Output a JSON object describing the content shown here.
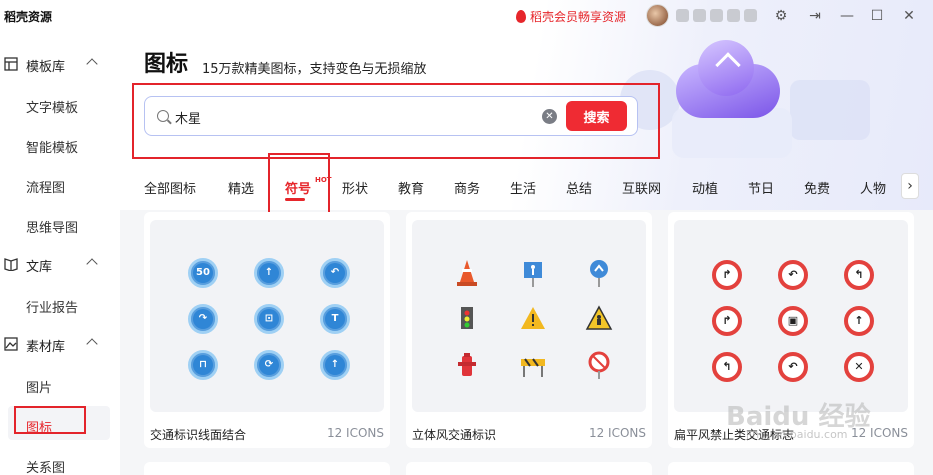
{
  "app": {
    "brand": "稻壳资源",
    "vip_label": "稻壳会员畅享资源"
  },
  "sidebar": {
    "groups": [
      {
        "label": "模板库",
        "icon": "template-icon",
        "items": [
          "文字模板",
          "智能模板",
          "流程图",
          "思维导图"
        ]
      },
      {
        "label": "文库",
        "icon": "book-icon",
        "items": [
          "行业报告"
        ]
      },
      {
        "label": "素材库",
        "icon": "image-icon",
        "items": [
          "图片",
          "图标",
          "关系图"
        ]
      }
    ],
    "active_item": "图标"
  },
  "header": {
    "title": "图标",
    "subtitle": "15万款精美图标，支持变色与无损缩放"
  },
  "search": {
    "value": "木星",
    "button_label": "搜索"
  },
  "tabs": {
    "items": [
      "全部图标",
      "精选",
      "符号",
      "形状",
      "教育",
      "商务",
      "生活",
      "总结",
      "互联网",
      "动植",
      "节日",
      "免费",
      "人物"
    ],
    "active": "符号",
    "hot_label": "HOT",
    "next_label": "›"
  },
  "cards": [
    {
      "title": "交通标识线面结合",
      "count": "12 ICONS",
      "icons": [
        "50",
        "↑",
        "↶",
        "↷",
        "⊡",
        "T",
        "⊓",
        "⟳",
        "↑"
      ]
    },
    {
      "title": "立体风交通标识",
      "count": "12 ICONS",
      "icons": [
        "cone",
        "sign-person",
        "sign-arrow",
        "traffic-light",
        "warning-sign",
        "warning-worker",
        "hydrant",
        "barrier",
        "no-turn"
      ]
    },
    {
      "title": "扁平风禁止类交通标志",
      "count": "12 ICONS",
      "icons": [
        "↱",
        "↶",
        "↰",
        "↱",
        "▣",
        "↑",
        "↰",
        "↶",
        "✕"
      ]
    }
  ],
  "watermark": {
    "text": "Baidu 经验",
    "url_text": "jingyan.baidu.com"
  },
  "colors": {
    "accent": "#e6262b",
    "search_border": "#b7c2f2",
    "sign_blue": "#2f86d6",
    "ban_red": "#e3413d"
  }
}
